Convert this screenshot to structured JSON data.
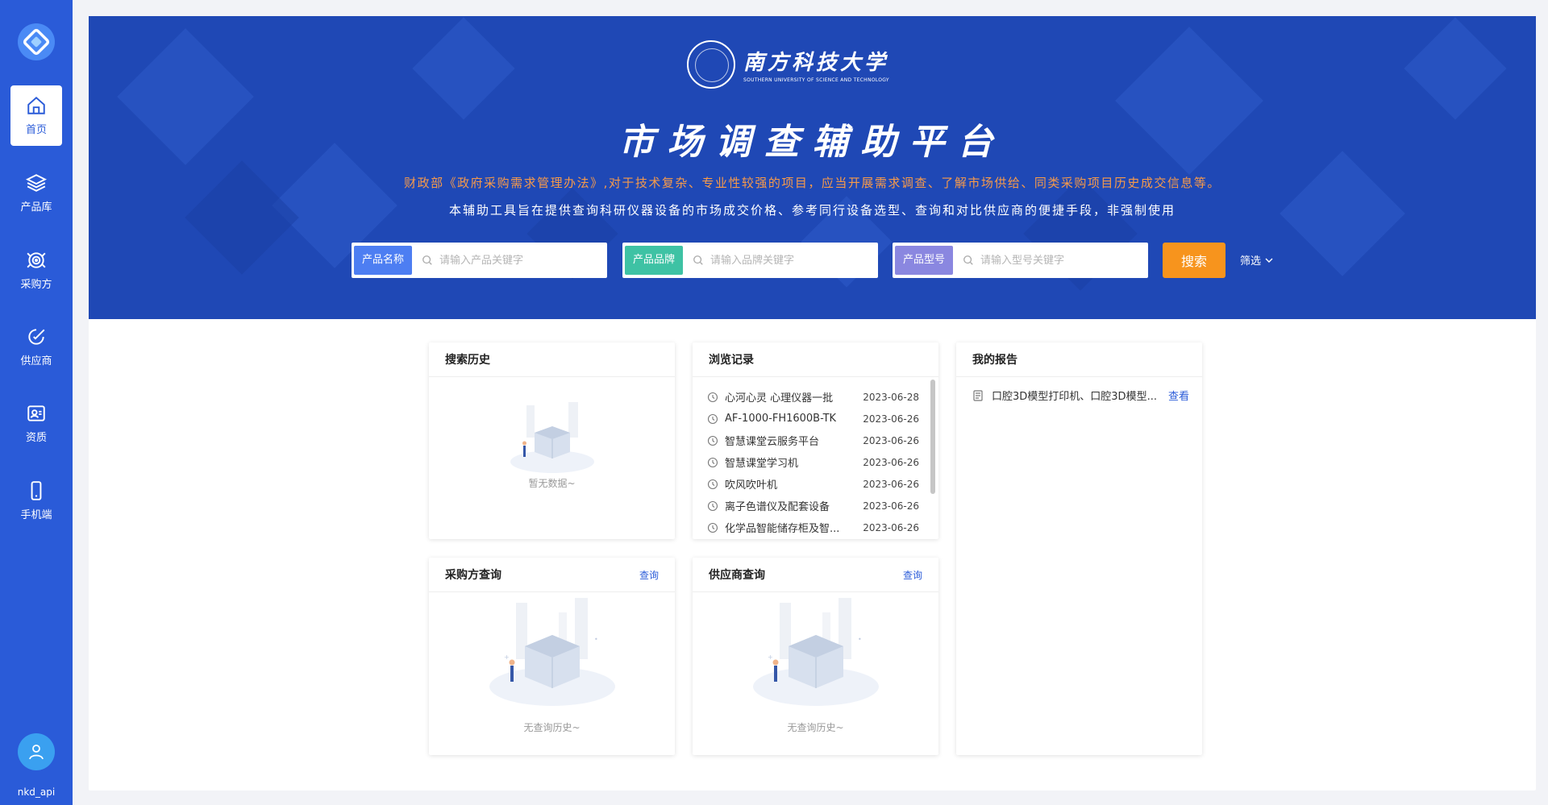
{
  "sidebar": {
    "items": [
      {
        "label": "首页",
        "icon": "home-icon"
      },
      {
        "label": "产品库",
        "icon": "layers-icon"
      },
      {
        "label": "采购方",
        "icon": "target-icon"
      },
      {
        "label": "供应商",
        "icon": "edit-circle-icon"
      },
      {
        "label": "资质",
        "icon": "id-card-icon"
      },
      {
        "label": "手机端",
        "icon": "mobile-icon"
      }
    ],
    "active": "首页",
    "user": {
      "name": "nkd_api",
      "icon": "user-icon"
    }
  },
  "banner": {
    "brand_cn": "南方科技大学",
    "brand_en": "SOUTHERN UNIVERSITY OF SCIENCE AND TECHNOLOGY",
    "title": "市场调查辅助平台",
    "subtitle1": "财政部《政府采购需求管理办法》,对于技术复杂、专业性较强的项目，应当开展需求调查、了解市场供给、同类采购项目历史成交信息等。",
    "subtitle2": "本辅助工具旨在提供查询科研仪器设备的市场成交价格、参考同行设备选型、查询和对比供应商的便捷手段，非强制使用"
  },
  "search": {
    "fields": [
      {
        "tag": "产品名称",
        "placeholder": "请输入产品关键字",
        "value": "",
        "color": "#4d7ef2"
      },
      {
        "tag": "产品品牌",
        "placeholder": "请输入品牌关键字",
        "value": "",
        "color": "#3ec2a4"
      },
      {
        "tag": "产品型号",
        "placeholder": "请输入型号关键字",
        "value": "",
        "color": "#8a87e0"
      }
    ],
    "button": "搜索",
    "filter": "筛选"
  },
  "panels": {
    "search_history": {
      "title": "搜索历史",
      "empty": "暂无数据~"
    },
    "browse": {
      "title": "浏览记录",
      "items": [
        {
          "name": "心河心灵 心理仪器一批",
          "date": "2023-06-28"
        },
        {
          "name": "AF-1000-FH1600B-TK",
          "date": "2023-06-26"
        },
        {
          "name": "智慧课堂云服务平台",
          "date": "2023-06-26"
        },
        {
          "name": "智慧课堂学习机",
          "date": "2023-06-26"
        },
        {
          "name": "吹风吹叶机",
          "date": "2023-06-26"
        },
        {
          "name": "离子色谱仪及配套设备",
          "date": "2023-06-26"
        },
        {
          "name": "化学品智能储存柜及智...",
          "date": "2023-06-26"
        }
      ]
    },
    "reports": {
      "title": "我的报告",
      "items": [
        {
          "name": "口腔3D模型打印机、口腔3D模型...",
          "link": "查看"
        }
      ]
    },
    "buyer_query": {
      "title": "采购方查询",
      "link": "查询",
      "empty": "无查询历史~"
    },
    "supplier_query": {
      "title": "供应商查询",
      "link": "查询",
      "empty": "无查询历史~"
    }
  },
  "colors": {
    "sidebar": "#2a5bd8",
    "banner": "#1f48b5",
    "accent_orange": "#f7941d",
    "link": "#2a5bd8"
  }
}
